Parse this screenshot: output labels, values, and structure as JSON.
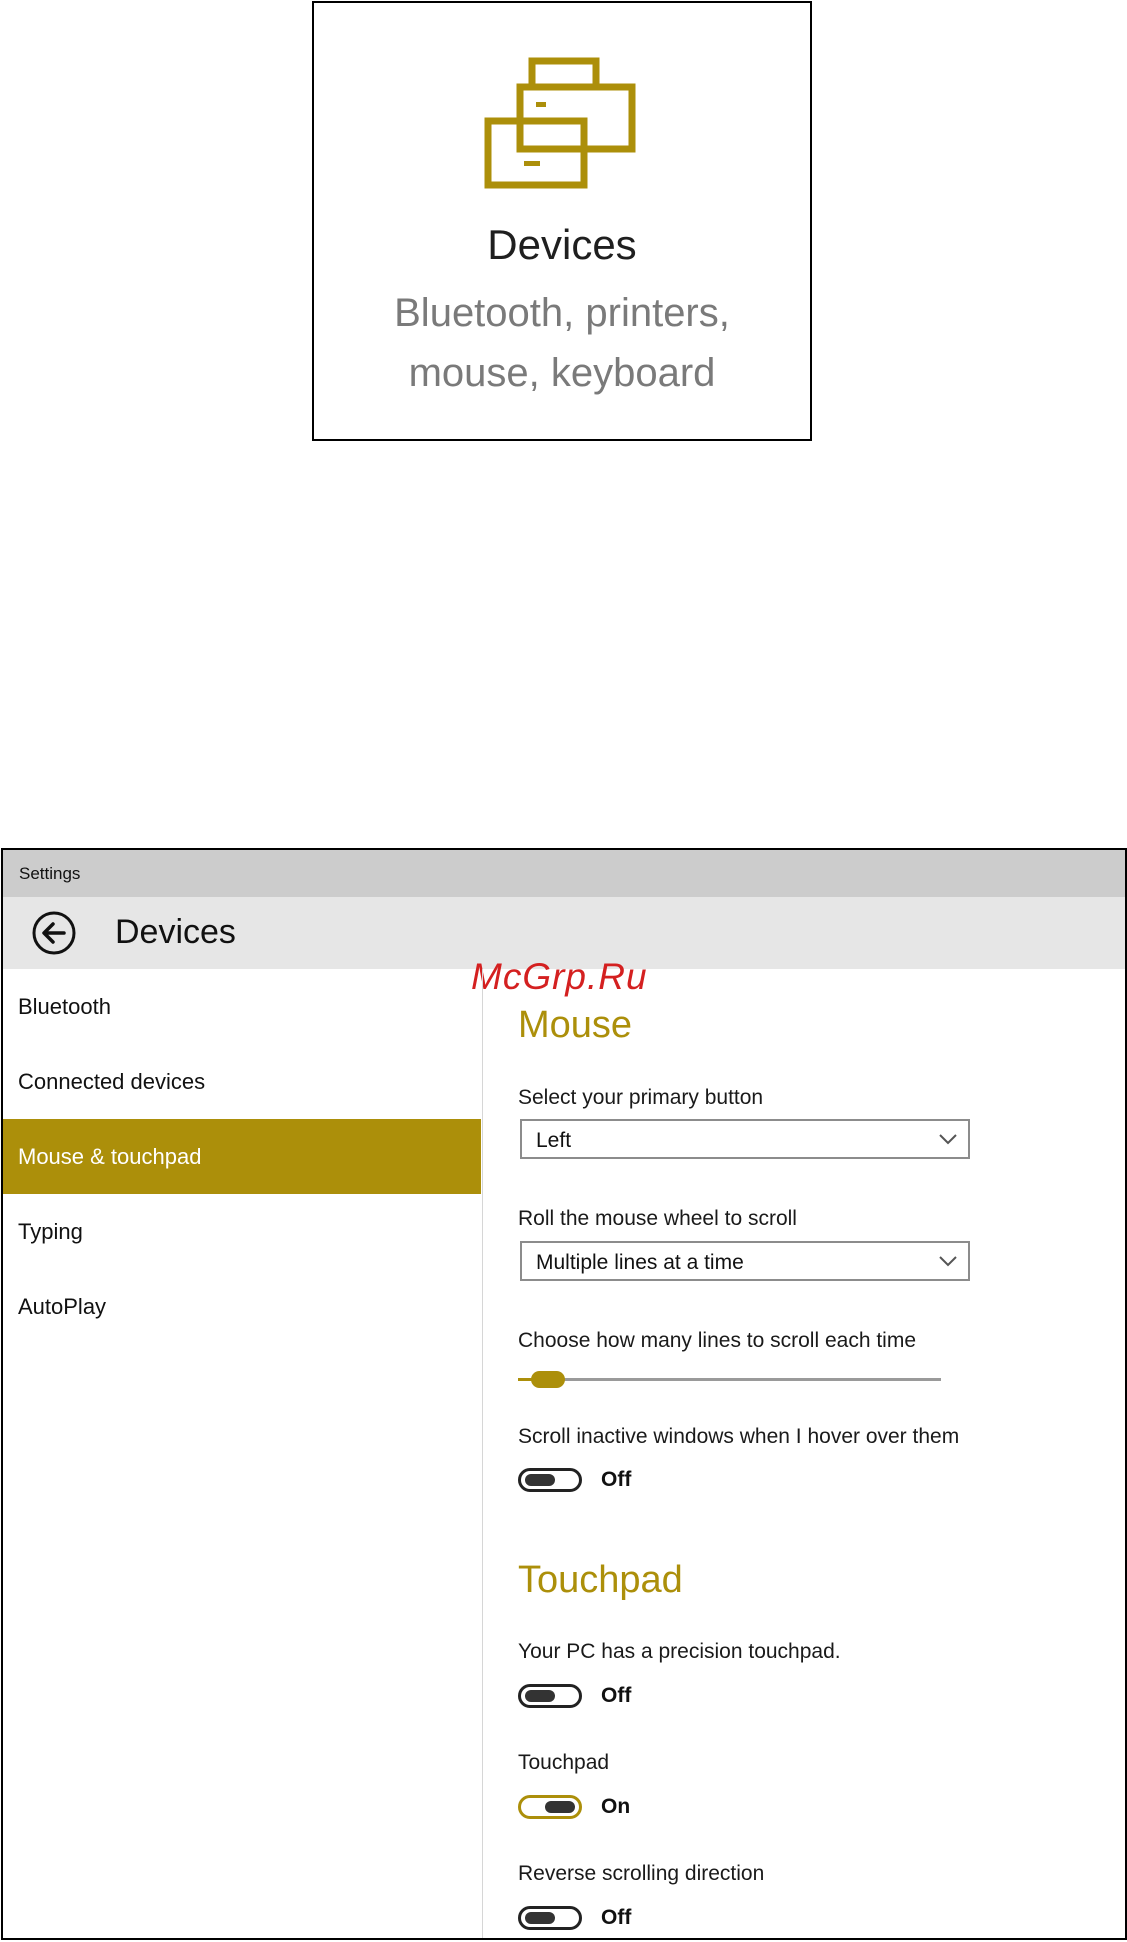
{
  "tile": {
    "title": "Devices",
    "description_line1": "Bluetooth, printers,",
    "description_line2": "mouse, keyboard",
    "icon": "printer-icon",
    "accent_color": "#ac8f0a"
  },
  "window": {
    "title": "Settings",
    "header_title": "Devices",
    "watermark": "McGrp.Ru"
  },
  "sidebar": {
    "items": [
      {
        "label": "Bluetooth",
        "active": false
      },
      {
        "label": "Connected devices",
        "active": false
      },
      {
        "label": "Mouse & touchpad",
        "active": true
      },
      {
        "label": "Typing",
        "active": false
      },
      {
        "label": "AutoPlay",
        "active": false
      }
    ]
  },
  "mouse": {
    "section_title": "Mouse",
    "primary_button": {
      "label": "Select your primary button",
      "value": "Left"
    },
    "wheel_scroll": {
      "label": "Roll the mouse wheel to scroll",
      "value": "Multiple lines at a time"
    },
    "lines_to_scroll": {
      "label": "Choose how many lines to scroll each time",
      "fraction": 0.05
    },
    "inactive_scroll": {
      "label": "Scroll inactive windows when I hover over them",
      "state": "Off"
    }
  },
  "touchpad": {
    "section_title": "Touchpad",
    "precision": {
      "label": "Your PC has a precision touchpad.",
      "state": "Off"
    },
    "touchpad_toggle": {
      "label": "Touchpad",
      "state": "On"
    },
    "reverse_scroll": {
      "label": "Reverse scrolling direction",
      "state": "Off"
    }
  }
}
